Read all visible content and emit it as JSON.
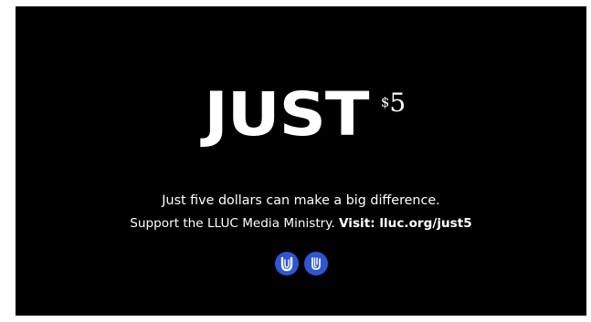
{
  "headline": {
    "word": "JUST",
    "currency_symbol": "$",
    "amount": "5"
  },
  "message": {
    "line1": "Just five dollars can make a big difference.",
    "line2_prefix": "Support the LLUC Media Ministry. ",
    "line2_visit": "Visit: lluc.org/just5"
  },
  "logos": [
    {
      "icon": "u-emblem-icon"
    },
    {
      "icon": "lluc-emblem-icon"
    }
  ],
  "colors": {
    "background": "#000000",
    "text": "#ffffff",
    "logo_accent": "#2c56d8"
  }
}
